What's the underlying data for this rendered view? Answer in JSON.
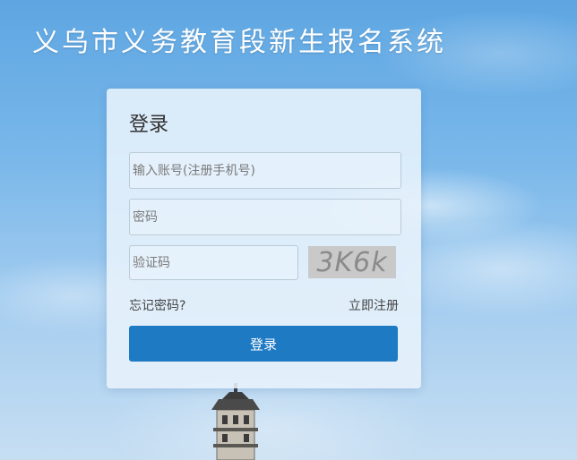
{
  "header": {
    "title": "义乌市义务教育段新生报名系统"
  },
  "login": {
    "title": "登录",
    "account_placeholder": "输入账号(注册手机号)",
    "password_placeholder": "密码",
    "captcha_placeholder": "验证码",
    "captcha_text": "3K6k",
    "forgot_password": "忘记密码?",
    "register": "立即注册",
    "submit": "登录"
  },
  "colors": {
    "primary_button": "#1f7ac4",
    "sky_top": "#5ea6e2",
    "panel_background": "#e8f2fc"
  }
}
